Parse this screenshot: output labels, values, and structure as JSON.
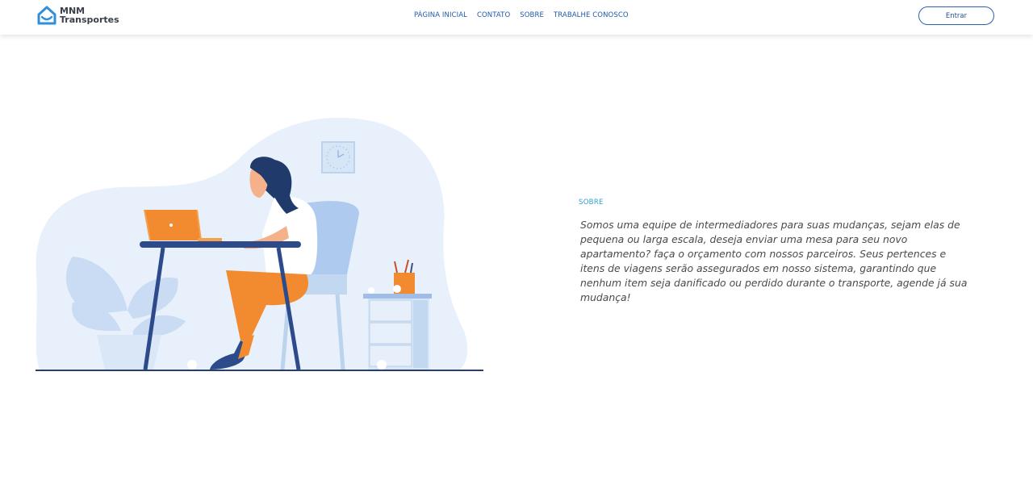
{
  "header": {
    "logo": {
      "line1": "MNM",
      "line2": "Transportes",
      "icon": "house-icon"
    },
    "nav": [
      {
        "label": "PÁGINA INICIAL"
      },
      {
        "label": "CONTATO"
      },
      {
        "label": "SOBRE"
      },
      {
        "label": "TRABALHE CONOSCO"
      }
    ],
    "login_label": "Entrar"
  },
  "about": {
    "section_label": "SOBRE",
    "text": "Somos uma equipe de intermediadores para suas mudanças, sejam elas de pequena ou larga escala, deseja enviar uma mesa para seu novo apartamento? faça o orçamento com nossos parceiros. Seus pertences e itens de viagens serão assegurados em nosso sistema, garantindo que nenhum item seja danificado ou perdido durante o transporte, agende já sua mudança!"
  },
  "colors": {
    "accent": "#1f5aa6",
    "teal": "#2ba3c9",
    "blob": "#e8f1fb",
    "orange": "#f28b2f",
    "navy": "#2d4a8a"
  }
}
